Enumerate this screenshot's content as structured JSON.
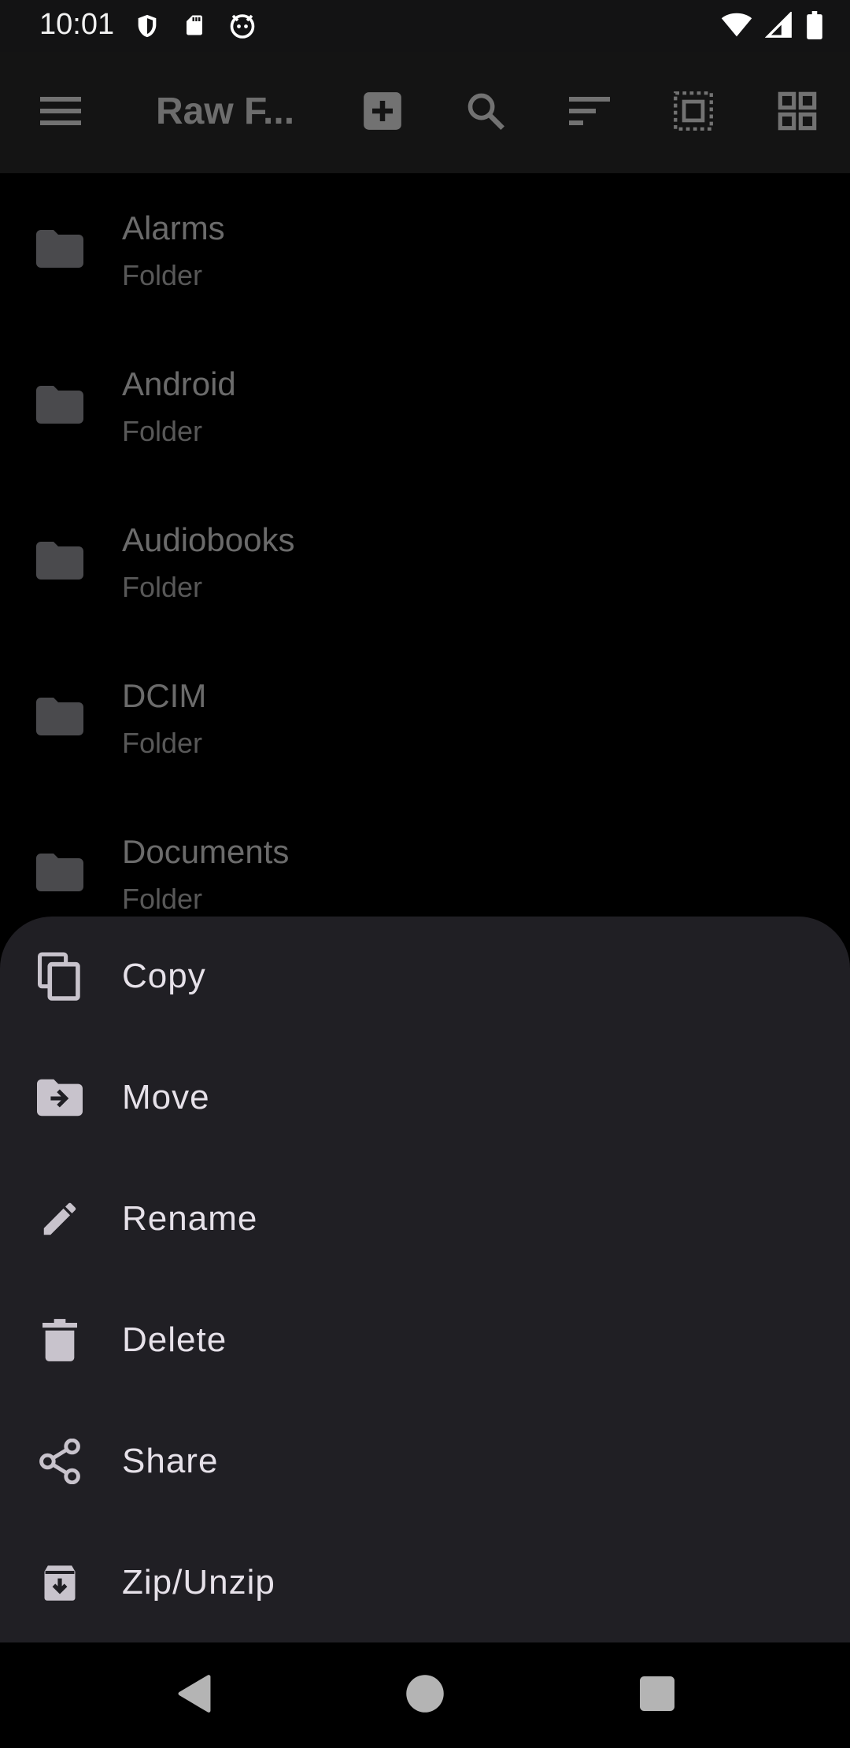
{
  "status_bar": {
    "time": "10:01",
    "left_icons": [
      "shield-icon",
      "sd-card-icon",
      "cat-face-icon"
    ],
    "right_icons": [
      "wifi-icon",
      "signal-icon",
      "battery-icon"
    ]
  },
  "toolbar": {
    "title": "Raw F...",
    "icons": [
      "menu-icon",
      "add-box-icon",
      "search-icon",
      "sort-icon",
      "select-all-icon",
      "grid-view-icon"
    ]
  },
  "files": [
    {
      "name": "Alarms",
      "type": "Folder"
    },
    {
      "name": "Android",
      "type": "Folder"
    },
    {
      "name": "Audiobooks",
      "type": "Folder"
    },
    {
      "name": "DCIM",
      "type": "Folder"
    },
    {
      "name": "Documents",
      "type": "Folder"
    }
  ],
  "sheet": {
    "items": [
      {
        "label": "Copy",
        "icon": "copy-icon"
      },
      {
        "label": "Move",
        "icon": "move-folder-icon"
      },
      {
        "label": "Rename",
        "icon": "pencil-icon"
      },
      {
        "label": "Delete",
        "icon": "trash-icon"
      },
      {
        "label": "Share",
        "icon": "share-icon"
      },
      {
        "label": "Zip/Unzip",
        "icon": "archive-icon"
      }
    ]
  },
  "nav_bar": {
    "icons": [
      "back-icon",
      "home-icon",
      "recents-icon"
    ]
  },
  "colors": {
    "background": "#000000",
    "toolbar": "#141414",
    "sheet": "#201f24",
    "sheet_text": "#e6e1e9",
    "dim_text": "#6b6b6b"
  }
}
